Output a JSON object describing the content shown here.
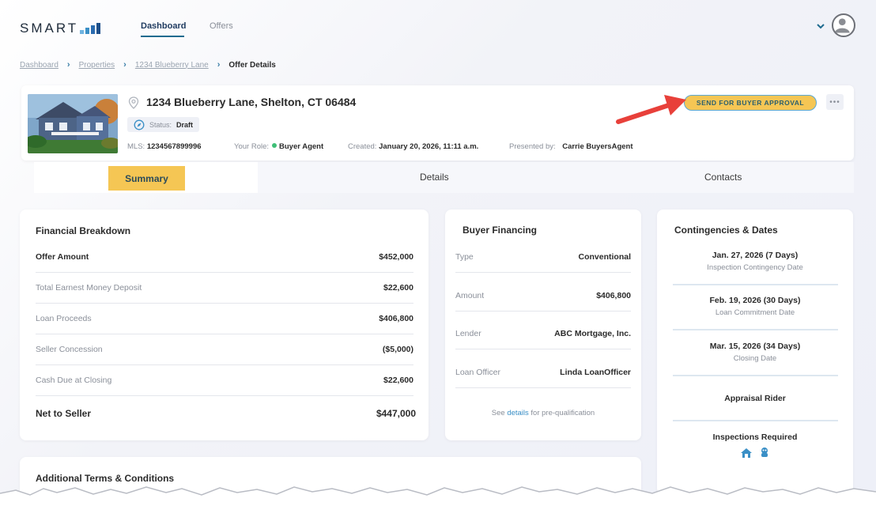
{
  "app": {
    "logo_text": "SMART",
    "nav": [
      {
        "label": "Dashboard",
        "active": true
      },
      {
        "label": "Offers",
        "active": false
      }
    ]
  },
  "breadcrumb": {
    "items": [
      "Dashboard",
      "Properties",
      "1234 Blueberry Lane"
    ],
    "current": "Offer Details"
  },
  "property": {
    "address": "1234 Blueberry Lane, Shelton, CT 06484",
    "status_label": "Status:",
    "status_value": "Draft",
    "mls_label": "MLS:",
    "mls_value": "1234567899996",
    "role_label": "Your Role:",
    "role_value": "Buyer Agent",
    "created_label": "Created:",
    "created_value": "January 20, 2026, 11:11 a.m.",
    "presented_label": "Presented by:",
    "presented_value": "Carrie BuyersAgent",
    "send_button": "SEND FOR BUYER APPROVAL",
    "more_button": "•••"
  },
  "tabs": {
    "summary": "Summary",
    "details": "Details",
    "contacts": "Contacts"
  },
  "financial": {
    "title": "Financial Breakdown",
    "rows": [
      {
        "label": "Offer Amount",
        "value": "$452,000"
      },
      {
        "label": "Total Earnest Money Deposit",
        "value": "$22,600"
      },
      {
        "label": "Loan Proceeds",
        "value": "$406,800"
      },
      {
        "label": "Seller Concession",
        "value": "($5,000)"
      },
      {
        "label": "Cash Due at Closing",
        "value": "$22,600"
      }
    ],
    "net_label": "Net to Seller",
    "net_value": "$447,000"
  },
  "financing": {
    "title": "Buyer Financing",
    "rows": [
      {
        "label": "Type",
        "value": "Conventional"
      },
      {
        "label": "Amount",
        "value": "$406,800"
      },
      {
        "label": "Lender",
        "value": "ABC Mortgage, Inc."
      },
      {
        "label": "Loan Officer",
        "value": "Linda LoanOfficer"
      }
    ],
    "footer_pre": "See",
    "footer_link": "details",
    "footer_post": "for pre-qualification"
  },
  "contingencies": {
    "title": "Contingencies & Dates",
    "items": [
      {
        "date": "Jan. 27, 2026 (7 Days)",
        "label": "Inspection Contingency Date"
      },
      {
        "date": "Feb. 19, 2026 (30 Days)",
        "label": "Loan Commitment Date"
      },
      {
        "date": "Mar. 15, 2026 (34 Days)",
        "label": "Closing Date"
      }
    ],
    "appraisal": "Appraisal Rider",
    "inspections": "Inspections Required"
  },
  "additional": {
    "title": "Additional Terms & Conditions"
  },
  "colors": {
    "accent_yellow": "#f5c654",
    "link_blue": "#3a8fc6",
    "arrow_red": "#e8403a",
    "status_green": "#3fbf77"
  }
}
